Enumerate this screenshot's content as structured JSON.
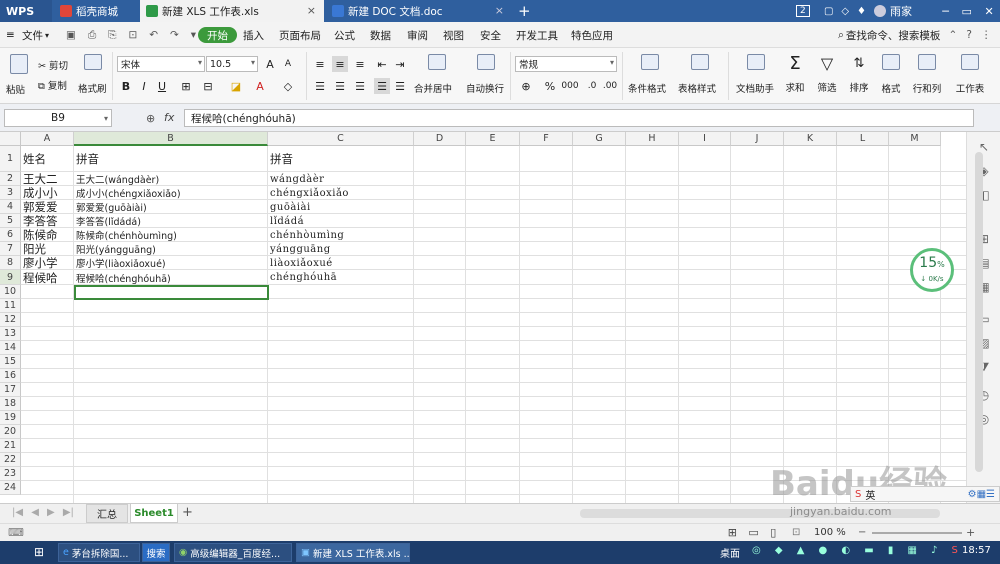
{
  "titlebar": {
    "app": "WPS",
    "tabs": [
      {
        "label": "稻壳商城"
      },
      {
        "label": "新建 XLS 工作表.xls"
      },
      {
        "label": "新建 DOC 文档.doc"
      }
    ],
    "new_tab": "+",
    "badge": "2",
    "user": "雨家"
  },
  "menubar": {
    "file": "文件",
    "items": [
      "开始",
      "插入",
      "页面布局",
      "公式",
      "数据",
      "审阅",
      "视图",
      "安全",
      "开发工具",
      "特色应用"
    ],
    "search": "查找命令、搜索模板"
  },
  "ribbon": {
    "paste": "粘贴",
    "cut": "剪切",
    "copy": "复制",
    "format_painter": "格式刷",
    "font_name": "宋体",
    "font_size": "10.5",
    "merge": "合并居中",
    "wrap": "自动换行",
    "number_format": "常规",
    "cond_format": "条件格式",
    "table_style": "表格样式",
    "doc_helper": "文档助手",
    "sum": "求和",
    "filter": "筛选",
    "sort": "排序",
    "format": "格式",
    "rows_cols": "行和列",
    "worksheet": "工作表",
    "percent": "%",
    "bold": "B",
    "italic": "I",
    "underline": "U"
  },
  "formula": {
    "cell_ref": "B9",
    "fx": "fx",
    "content": "程候哈(chénghóuhā)"
  },
  "columns": [
    "A",
    "B",
    "C",
    "D",
    "E",
    "F",
    "G",
    "H",
    "I",
    "J",
    "K",
    "L",
    "M"
  ],
  "rows": [
    "1",
    "2",
    "3",
    "4",
    "5",
    "6",
    "7",
    "8",
    "9",
    "10",
    "11",
    "12",
    "13",
    "14",
    "15",
    "16",
    "17",
    "18",
    "19",
    "20",
    "21",
    "22",
    "23",
    "24"
  ],
  "table": [
    [
      "姓名",
      "拼音",
      "拼音"
    ],
    [
      "王大二",
      "王大二(wángdàèr)",
      "wángdàèr"
    ],
    [
      "成小小",
      "成小小(chéngxiǎoxiǎo)",
      "chéngxiǎoxiǎo"
    ],
    [
      "郭爱爱",
      "郭爱爱(guōàiài)",
      "guōàiài"
    ],
    [
      "李答答",
      "李答答(lǐdádá)",
      "lǐdádá"
    ],
    [
      "陈候命",
      "陈候命(chénhòumìng)",
      "chénhòumìng"
    ],
    [
      "阳光",
      "阳光(yángguāng)",
      "yángguāng"
    ],
    [
      "廖小学",
      "廖小学(liàoxiǎoxué)",
      "liàoxiǎoxué"
    ],
    [
      "程候哈",
      "程候哈(chénghóuhā)",
      "chénghóuhā"
    ]
  ],
  "sheets": {
    "tabs": [
      "汇总",
      "Sheet1"
    ],
    "add": "+"
  },
  "status": {
    "zoom": "100 %"
  },
  "speed": {
    "percent": "15",
    "unit": "%",
    "rate": "0K/s"
  },
  "taskbar": {
    "search": "搜索",
    "tasks": [
      "茅台拆除国...",
      "高级编辑器_百度经...",
      "新建 XLS 工作表.xls ..."
    ],
    "desktop": "桌面",
    "time": "18:57"
  },
  "watermark": "Baidu经验",
  "watermark_url": "jingyan.baidu.com",
  "ime": "英"
}
